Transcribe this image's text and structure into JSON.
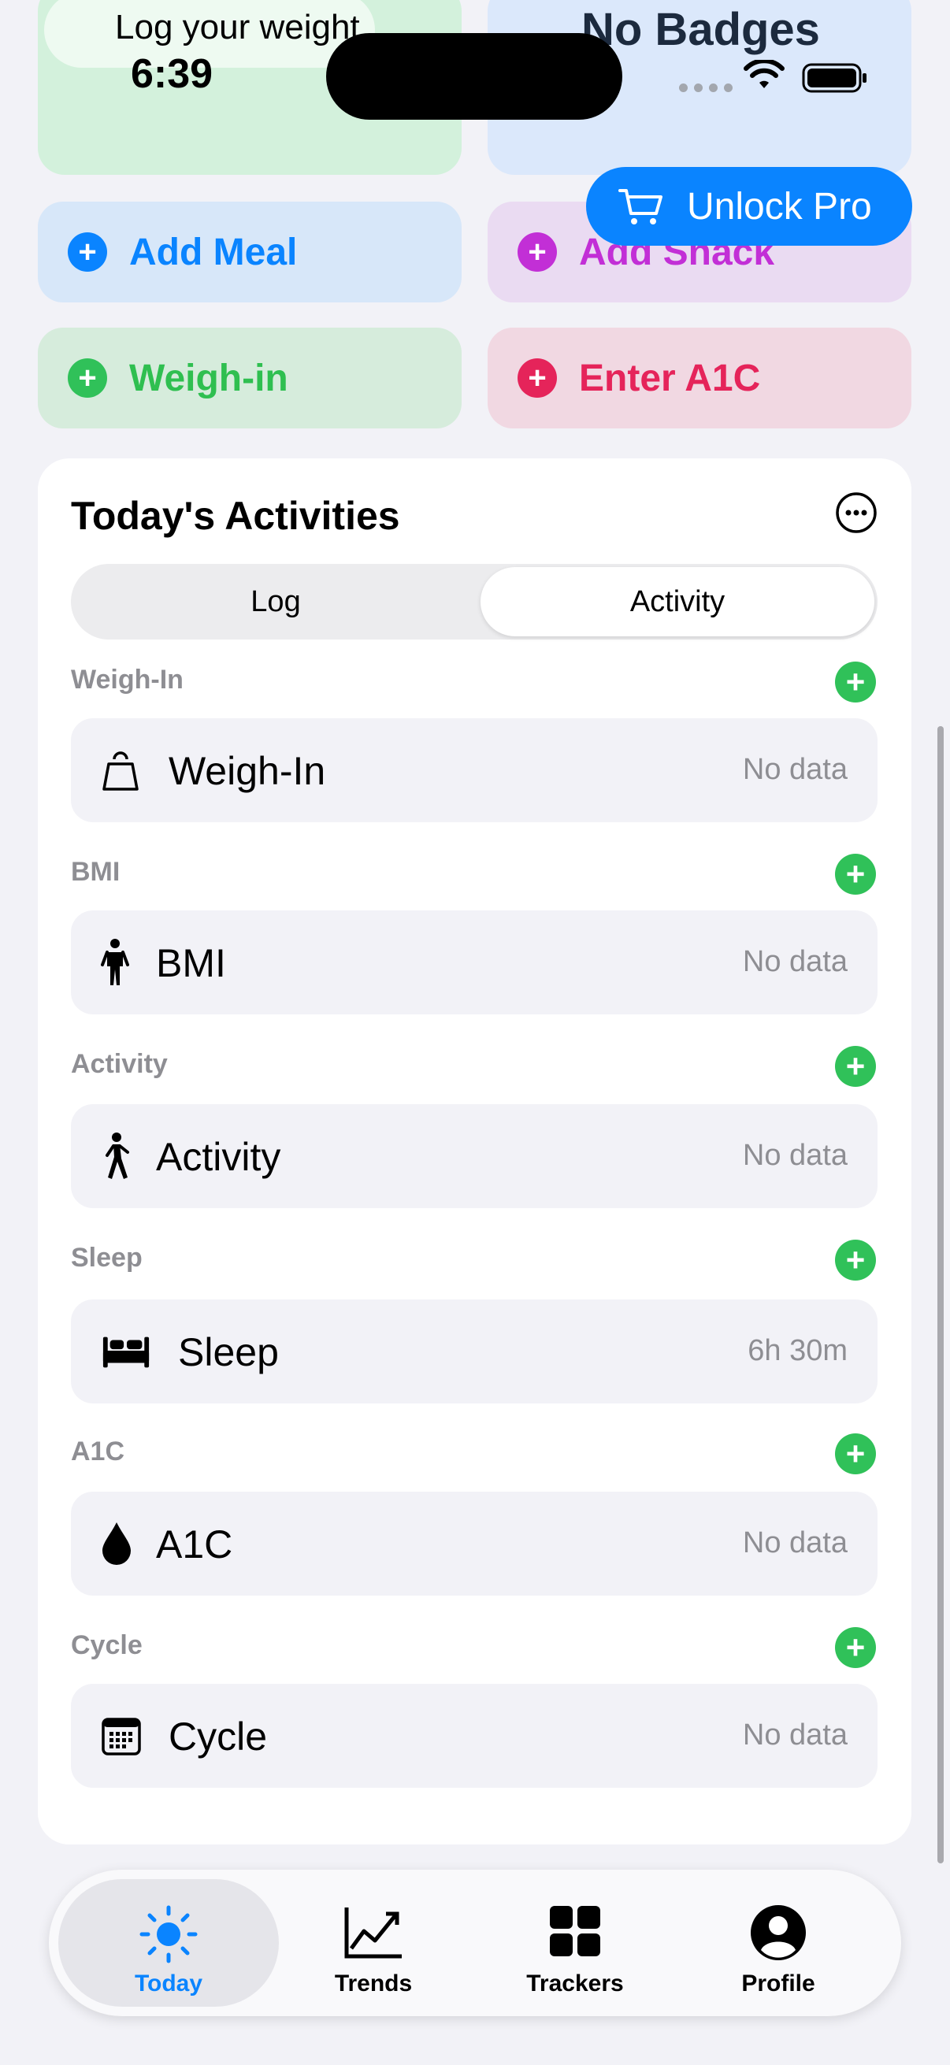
{
  "status_bar": {
    "time": "6:39"
  },
  "top_cards": {
    "weight_prompt": "Log your weight",
    "badges_text": "No Badges"
  },
  "unlock_pro": {
    "label": "Unlock Pro"
  },
  "quick_actions": {
    "add_meal": "Add Meal",
    "add_snack": "Add Snack",
    "weigh_in": "Weigh-in",
    "enter_a1c": "Enter A1C"
  },
  "activities": {
    "title": "Today's Activities",
    "segments": {
      "log": "Log",
      "activity": "Activity",
      "selected": "Activity"
    },
    "sections": [
      {
        "header": "Weigh-In",
        "label": "Weigh-In",
        "value": "No data",
        "icon": "scale-icon"
      },
      {
        "header": "BMI",
        "label": "BMI",
        "value": "No data",
        "icon": "figure-stand-icon"
      },
      {
        "header": "Activity",
        "label": "Activity",
        "value": "No data",
        "icon": "figure-walk-icon"
      },
      {
        "header": "Sleep",
        "label": "Sleep",
        "value": "6h 30m",
        "icon": "bed-icon"
      },
      {
        "header": "A1C",
        "label": "A1C",
        "value": "No data",
        "icon": "drop-icon"
      },
      {
        "header": "Cycle",
        "label": "Cycle",
        "value": "No data",
        "icon": "calendar-icon"
      }
    ]
  },
  "tab_bar": {
    "active": "Today",
    "tabs": [
      {
        "label": "Today",
        "icon": "sun-icon"
      },
      {
        "label": "Trends",
        "icon": "chart-line-icon"
      },
      {
        "label": "Trackers",
        "icon": "grid-icon"
      },
      {
        "label": "Profile",
        "icon": "person-circle-icon"
      }
    ]
  },
  "colors": {
    "accent_blue": "#0a84ff",
    "green": "#30c159",
    "pink": "#e5245a",
    "purple": "#c22fd6"
  }
}
